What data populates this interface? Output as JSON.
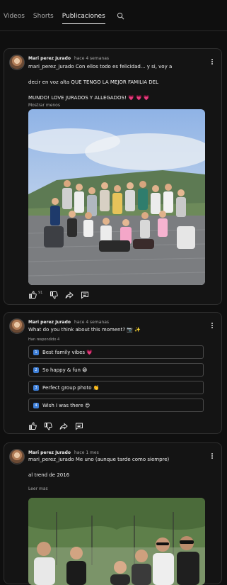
{
  "tabs": {
    "videos": "Videos",
    "shorts": "Shorts",
    "publicaciones": "Publicaciones",
    "search_icon": "search-icon"
  },
  "post1": {
    "author": "Mari perez Jurado",
    "ago": "hace 4 semanas",
    "line1": "mari_perez_jurado Con ellos todo es felicidad... y si, voy a",
    "line2": "decir en voz alta QUE TENGO LA MEJOR FAMILIA DEL",
    "line3": "MUNDO! LOVE JURADOS Y ALLEGADOS! 💗 💗 💗",
    "show_less": "Mostrar menos",
    "likes": "91"
  },
  "post2": {
    "author": "Mari perez Jurado",
    "ago": "hace 4 semanas",
    "question": "What do you think about this moment? 📷 ✨",
    "replied": "Han respondido 4",
    "options": [
      {
        "badge": "1",
        "text": "Best family vibes 💗"
      },
      {
        "badge": "2",
        "text": "So happy & fun 😁"
      },
      {
        "badge": "3",
        "text": "Perfect group photo 👏"
      },
      {
        "badge": "4",
        "text": "Wish I was there 😍"
      }
    ]
  },
  "post3": {
    "author": "Mari perez Jurado",
    "ago": "hace 1 mes",
    "line1": "mari_perez_jurado Me uno (aunque tarde como siempre)",
    "line2": "al trend de 2016",
    "read_more": "Leer mas"
  },
  "colors": {
    "background": "#0f0f0f",
    "card": "#141414",
    "accent": "#3e7fd8"
  }
}
